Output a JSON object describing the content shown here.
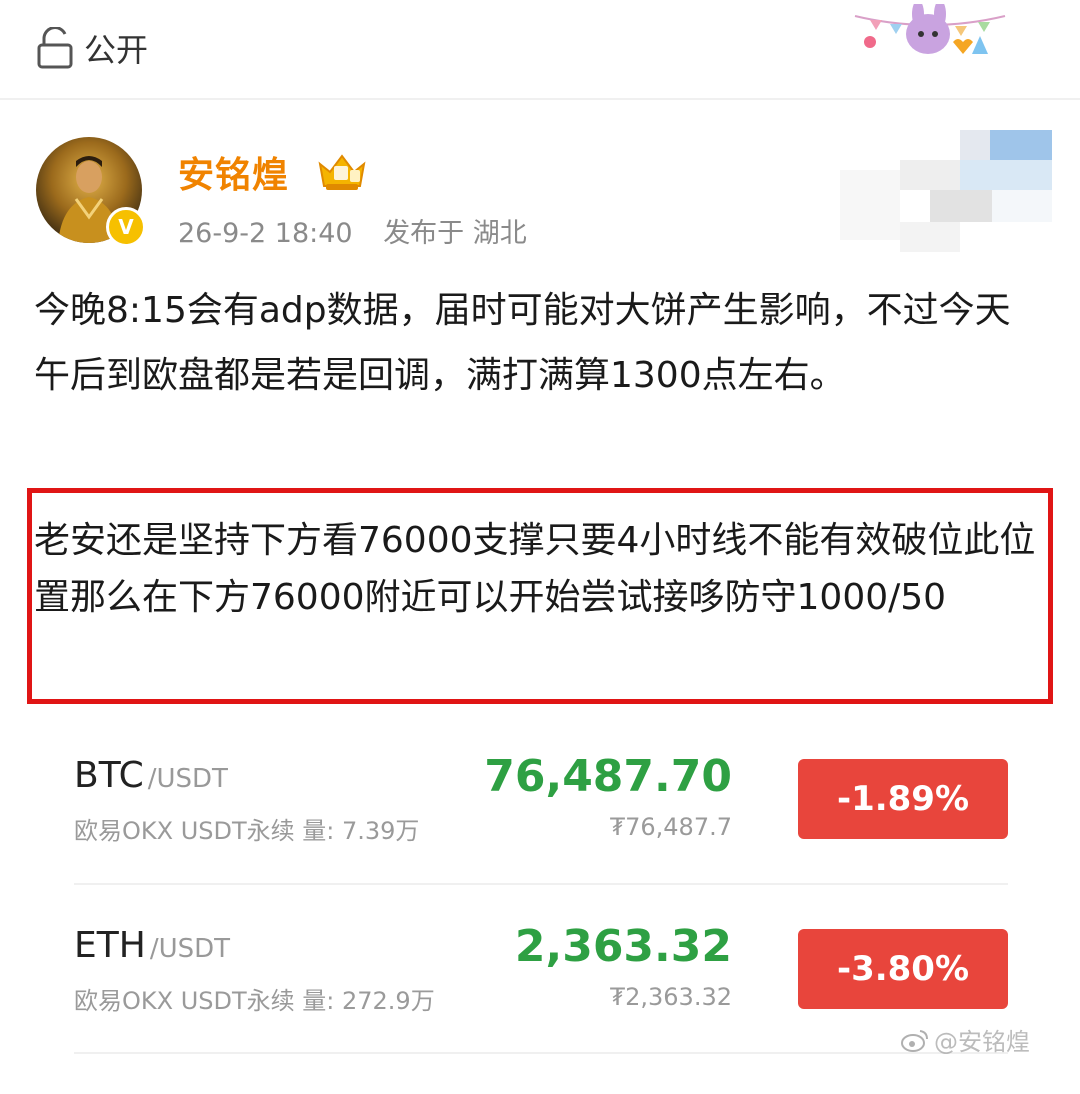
{
  "visibility": {
    "label": "公开",
    "icon": "lock-open-icon"
  },
  "author": {
    "name": "安铭煌",
    "badge_icon": "crown-badge-icon",
    "verified_icon": "verified-v-icon",
    "timestamp": "26-9-2 18:40",
    "location": "发布于 湖北"
  },
  "post": {
    "text": "今晚8:15会有adp数据，届时可能对大饼产生影响，不过今天午后到欧盘都是若是回调，满打满算1300点左右。",
    "highlight": "老安还是坚持下方看76000支撑只要4小时线不能有效破位此位置那么在下方76000附近可以开始尝试接哆防守1000/50"
  },
  "tickers": [
    {
      "symbol": "BTC",
      "quote": "/USDT",
      "market": "欧易OKX USDT永续  量: 7.39万",
      "price": "76,487.70",
      "fiat": "₮76,487.7",
      "change": "-1.89%"
    },
    {
      "symbol": "ETH",
      "quote": "/USDT",
      "market": "欧易OKX USDT永续  量: 272.9万",
      "price": "2,363.32",
      "fiat": "₮2,363.32",
      "change": "-3.80%"
    }
  ],
  "colors": {
    "author_name": "#f08300",
    "price_green": "#2ea043",
    "change_red": "#e8453c",
    "highlight_border": "#e01515"
  },
  "watermark": "@安铭煌"
}
